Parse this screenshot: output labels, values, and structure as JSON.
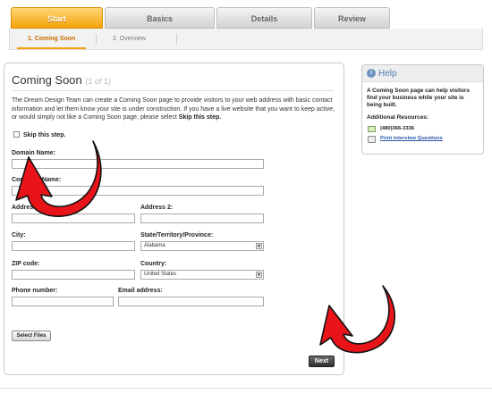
{
  "tabs": [
    {
      "label": "Start",
      "active": true
    },
    {
      "label": "Basics",
      "active": false
    },
    {
      "label": "Details",
      "active": false
    },
    {
      "label": "Review",
      "active": false
    }
  ],
  "subtabs": [
    {
      "label": "1. Coming Soon",
      "active": true
    },
    {
      "label": "2. Overview",
      "active": false
    }
  ],
  "main": {
    "title": "Coming Soon",
    "title_count": "(1 of 1)",
    "description": "The Dream Design Team can create a Coming Soon page to provide visitors to your web address with basic contact information and let them know your site is under construction. If you have a live website that you want to keep active, or would simply not like a Coming Soon page, please select",
    "description_strong": "Skip this step.",
    "skip_label": "Skip this step.",
    "fields": {
      "domain_name": {
        "label": "Domain Name:",
        "value": ""
      },
      "company_name": {
        "label": "Company Name:",
        "value": ""
      },
      "address1": {
        "label": "Address 1:",
        "value": ""
      },
      "address2": {
        "label": "Address 2:",
        "value": ""
      },
      "city": {
        "label": "City:",
        "value": ""
      },
      "state": {
        "label": "State/Territory/Province:",
        "value": "Alabama"
      },
      "zip": {
        "label": "ZIP code:",
        "value": ""
      },
      "country": {
        "label": "Country:",
        "value": "United States"
      },
      "phone": {
        "label": "Phone number:",
        "value": ""
      },
      "email": {
        "label": "Email address:",
        "value": ""
      }
    },
    "select_files_label": "Select Files",
    "next_label": "Next"
  },
  "help": {
    "title": "Help",
    "text": "A Coming Soon page can help visitors find your business while your site is being built.",
    "resources_label": "Additional Resources:",
    "phone": "(480)366-3336",
    "print_link": "Print Interview Questions"
  },
  "colors": {
    "tab_active": "#f5a20c",
    "help_title": "#4d7bb0",
    "arrow_red": "#e8141a"
  },
  "icons": {
    "help": "info-icon",
    "phone": "phone-icon",
    "print": "printer-icon",
    "annotation_arrows": "red-curved-arrow"
  }
}
